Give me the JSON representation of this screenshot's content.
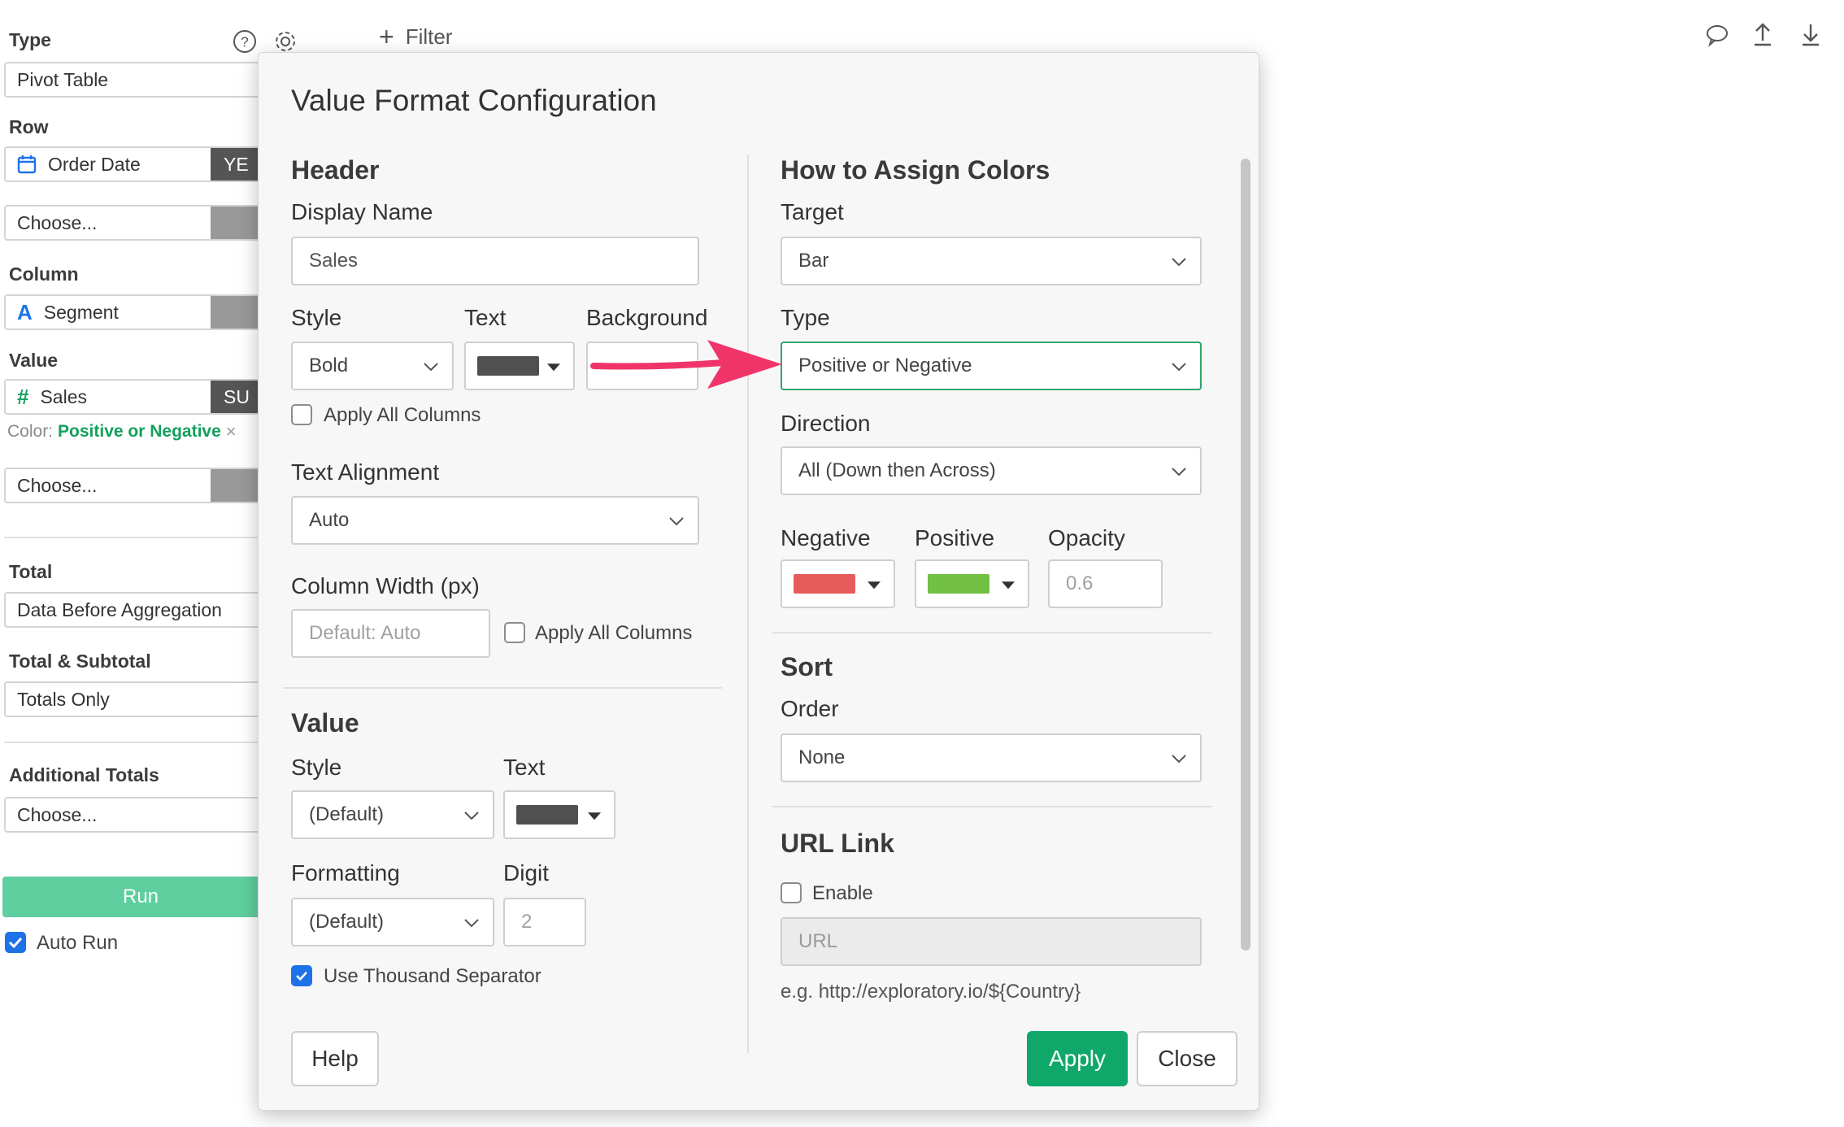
{
  "topbar": {
    "filter_label": "Filter"
  },
  "left_panel": {
    "type_label": "Type",
    "type_value": "Pivot Table",
    "row_label": "Row",
    "row_field": "Order Date",
    "row_field_tag": "YE",
    "row_choose": "Choose...",
    "column_label": "Column",
    "column_field": "Segment",
    "value_label": "Value",
    "value_field": "Sales",
    "value_field_tag": "SU",
    "color_prefix": "Color:",
    "color_value": "Positive or Negative",
    "value_choose": "Choose...",
    "total_label": "Total",
    "total_value": "Data Before Aggregation",
    "subtotal_label": "Total & Subtotal",
    "subtotal_value": "Totals Only",
    "additional_label": "Additional Totals",
    "additional_choose": "Choose...",
    "run_label": "Run",
    "auto_run_label": "Auto Run",
    "auto_run_checked": true
  },
  "modal": {
    "title": "Value Format Configuration",
    "header_section": {
      "title": "Header",
      "display_name_label": "Display Name",
      "display_name_value": "Sales",
      "style_label": "Style",
      "style_value": "Bold",
      "text_label": "Text",
      "text_color": "#505050",
      "background_label": "Background",
      "apply_all_label": "Apply All Columns",
      "text_alignment_label": "Text Alignment",
      "text_alignment_value": "Auto",
      "column_width_label": "Column Width (px)",
      "column_width_placeholder": "Default: Auto",
      "width_apply_all_label": "Apply All Columns"
    },
    "value_section": {
      "title": "Value",
      "style_label": "Style",
      "style_value": "(Default)",
      "text_label": "Text",
      "text_color": "#505050",
      "formatting_label": "Formatting",
      "formatting_value": "(Default)",
      "digit_label": "Digit",
      "digit_placeholder": "2",
      "thousand_sep_label": "Use Thousand Separator",
      "thousand_sep_checked": true
    },
    "colors_section": {
      "title": "How to Assign Colors",
      "target_label": "Target",
      "target_value": "Bar",
      "type_label": "Type",
      "type_value": "Positive or Negative",
      "direction_label": "Direction",
      "direction_value": "All (Down then Across)",
      "negative_label": "Negative",
      "negative_color": "#e85b5b",
      "positive_label": "Positive",
      "positive_color": "#72c045",
      "opacity_label": "Opacity",
      "opacity_placeholder": "0.6"
    },
    "sort_section": {
      "title": "Sort",
      "order_label": "Order",
      "order_value": "None"
    },
    "url_section": {
      "title": "URL Link",
      "enable_label": "Enable",
      "url_placeholder": "URL",
      "example_text": "e.g. http://exploratory.io/${Country}"
    },
    "buttons": {
      "help": "Help",
      "apply": "Apply",
      "close": "Close"
    }
  },
  "colors": {
    "accent_green": "#10a86a",
    "run_button": "#5fcf9f",
    "arrow": "#f0346a",
    "link_green": "#14a05c"
  }
}
